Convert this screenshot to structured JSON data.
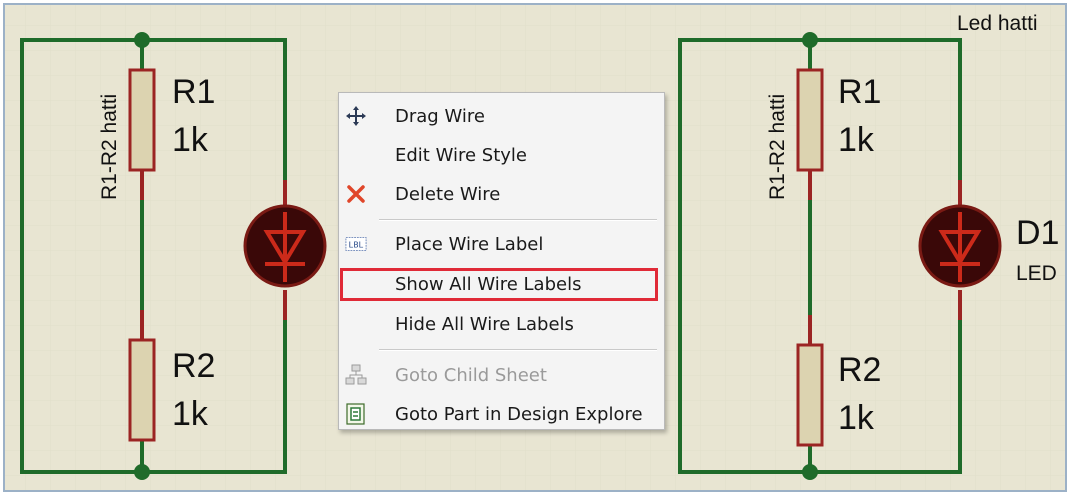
{
  "colors": {
    "background": "#e8e5d2",
    "wire": "#1f6b2a",
    "resistor_border": "#9b2423",
    "resistor_fill": "#dcd3b0",
    "led_fill": "#3a0808",
    "led_symbol": "#cc2a1a",
    "highlight": "#e02a37",
    "menu_bg": "#f4f4f4"
  },
  "left_circuit": {
    "wire_label": "R1-R2 hatti",
    "r1": {
      "name": "R1",
      "value": "1k"
    },
    "r2": {
      "name": "R2",
      "value": "1k"
    }
  },
  "right_circuit": {
    "wire_label_top": "Led hatti",
    "wire_label": "R1-R2 hatti",
    "r1": {
      "name": "R1",
      "value": "1k"
    },
    "r2": {
      "name": "R2",
      "value": "1k"
    },
    "d1": {
      "name": "D1",
      "type": "LED"
    }
  },
  "context_menu": {
    "items": [
      {
        "label": "Drag Wire",
        "icon": "move-arrows-icon",
        "enabled": true
      },
      {
        "label": "Edit Wire Style",
        "icon": "",
        "enabled": true
      },
      {
        "label": "Delete Wire",
        "icon": "red-x-icon",
        "enabled": true
      },
      {
        "label": "Place Wire Label",
        "icon": "lbl-icon",
        "enabled": true
      },
      {
        "label": "Show All Wire Labels",
        "icon": "",
        "enabled": true,
        "highlighted": true
      },
      {
        "label": "Hide All Wire Labels",
        "icon": "",
        "enabled": true
      },
      {
        "label": "Goto Child Sheet",
        "icon": "hierarchy-icon",
        "enabled": false
      },
      {
        "label": "Goto Part in Design Explore",
        "icon": "design-explorer-icon",
        "enabled": true
      }
    ]
  }
}
